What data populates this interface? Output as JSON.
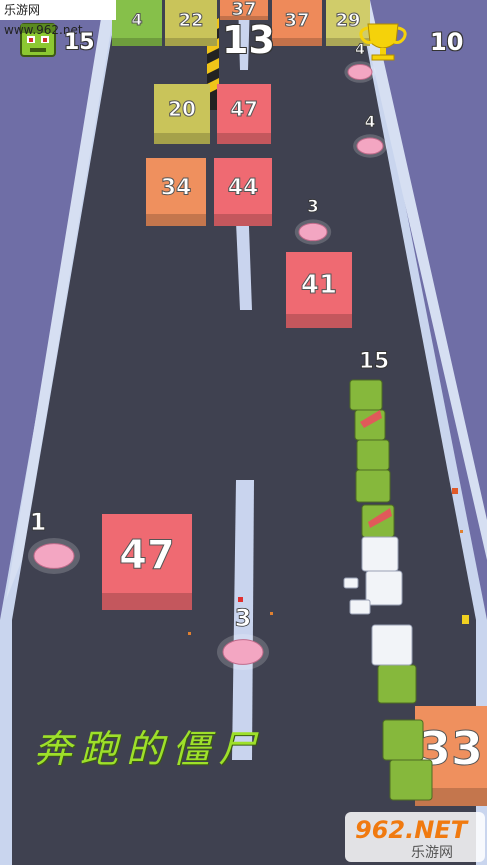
{
  "watermark": "乐游网 www.962.net",
  "hud": {
    "zombie_count": "15",
    "level": "13",
    "trophy_score": "10",
    "colors": {
      "text": "#ffffff",
      "trophy": "#f5d20a",
      "zombie_icon": "#8cc832"
    }
  },
  "blocks": [
    {
      "label": "4",
      "color": "#86c04a"
    },
    {
      "label": "22",
      "color": "#c9c45a"
    },
    {
      "label": "37",
      "color": "#ee8a5a"
    },
    {
      "label": "37",
      "color": "#ee8a5a"
    },
    {
      "label": "29",
      "color": "#d0cc6a"
    },
    {
      "label": "20",
      "color": "#c9c45a"
    },
    {
      "label": "47",
      "color": "#ef6a72"
    },
    {
      "label": "34",
      "color": "#ef905e"
    },
    {
      "label": "44",
      "color": "#ef6a72"
    },
    {
      "label": "41",
      "color": "#ef6a72"
    },
    {
      "label": "47",
      "color": "#ef6a72"
    },
    {
      "label": "33",
      "color": "#ef905e"
    }
  ],
  "brains": [
    {
      "label": "4"
    },
    {
      "label": "4"
    },
    {
      "label": "3"
    },
    {
      "label": "1"
    },
    {
      "label": "3"
    }
  ],
  "horde": {
    "label": "15"
  },
  "caption": "奔跑的僵尸",
  "logo": {
    "main": "962.NET",
    "sub": "乐游网"
  }
}
